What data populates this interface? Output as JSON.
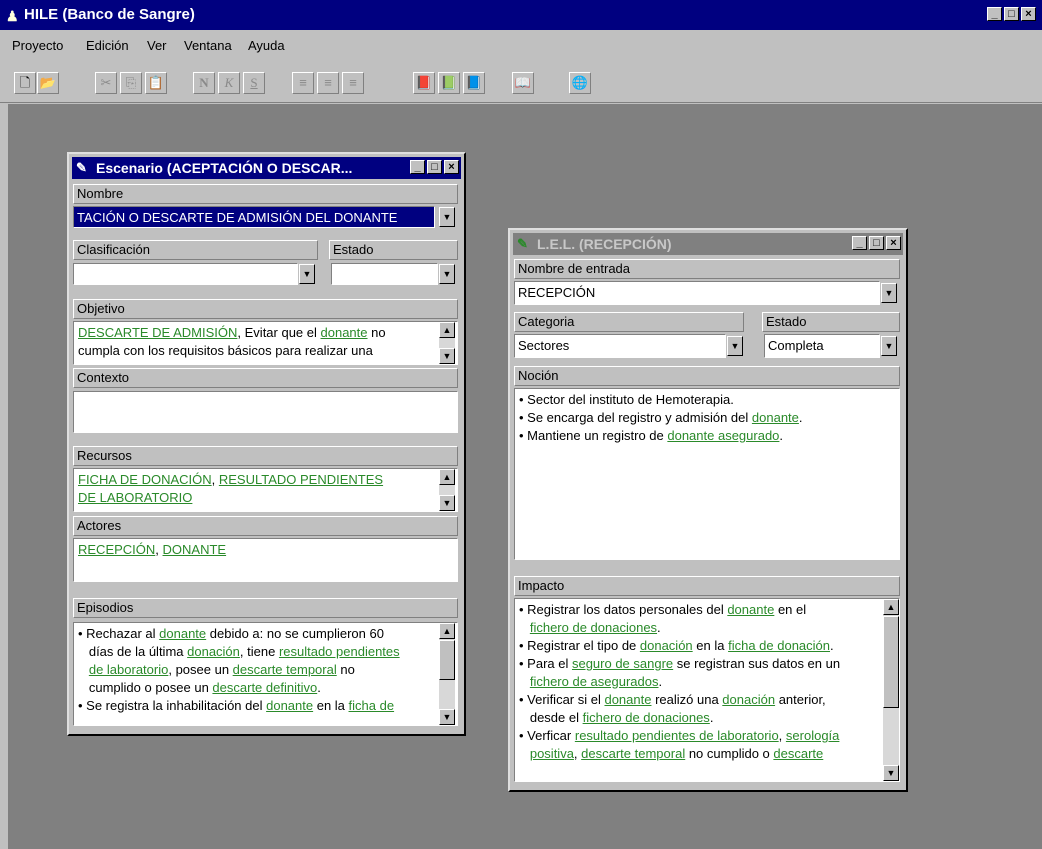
{
  "app": {
    "title": "HILE (Banco de Sangre)",
    "icon": "people-icon",
    "controls": [
      "_",
      "□",
      "×"
    ]
  },
  "menu": [
    "Proyecto",
    "Edición",
    "Ver",
    "Ventana",
    "Ayuda"
  ],
  "toolbar": {
    "buttons": [
      {
        "name": "new-file-icon",
        "glyph": "🗋",
        "enabled": true
      },
      {
        "name": "open-folder-icon",
        "glyph": "📂",
        "enabled": true
      },
      {
        "name": "cut-icon",
        "glyph": "✂",
        "enabled": false
      },
      {
        "name": "copy-icon",
        "glyph": "⎘",
        "enabled": false
      },
      {
        "name": "paste-icon",
        "glyph": "📋",
        "enabled": false
      },
      {
        "name": "bold-icon",
        "glyph": "N",
        "enabled": false
      },
      {
        "name": "italic-icon",
        "glyph": "K",
        "enabled": false
      },
      {
        "name": "underline-icon",
        "glyph": "S",
        "enabled": false
      },
      {
        "name": "align-left-icon",
        "glyph": "≡",
        "enabled": false
      },
      {
        "name": "align-center-icon",
        "glyph": "≡",
        "enabled": false
      },
      {
        "name": "align-right-icon",
        "glyph": "≡",
        "enabled": false
      },
      {
        "name": "scenario-book-icon",
        "glyph": "📕",
        "enabled": true
      },
      {
        "name": "lel-green-book-icon",
        "glyph": "📗",
        "enabled": true
      },
      {
        "name": "blue-book-icon",
        "glyph": "📘",
        "enabled": true
      },
      {
        "name": "open-book-icon",
        "glyph": "📖",
        "enabled": true
      },
      {
        "name": "help-globe-icon",
        "glyph": "🌐",
        "enabled": true
      }
    ]
  },
  "scenario": {
    "title": "Escenario (ACEPTACIÓN O DESCAR...",
    "nombre_label": "Nombre",
    "nombre_value": "TACIÓN O DESCARTE DE ADMISIÓN DEL DONANTE",
    "clasificacion_label": "Clasificación",
    "clasificacion_value": "",
    "estado_label": "Estado",
    "estado_value": "",
    "objetivo_label": "Objetivo",
    "contexto_label": "Contexto",
    "recursos_label": "Recursos",
    "actores_label": "Actores",
    "episodios_label": "Episodios",
    "objetivo": [
      [
        {
          "t": "DESCARTE DE ADMISIÓN",
          "l": true
        },
        {
          "t": ", Evitar que el "
        },
        {
          "t": "donante",
          "l": true
        },
        {
          "t": " no"
        }
      ],
      [
        {
          "t": "cumpla con los requisitos básicos para realizar una"
        }
      ]
    ],
    "recursos": [
      [
        {
          "t": "FICHA DE DONACIÓN",
          "l": true
        },
        {
          "t": ", "
        },
        {
          "t": "RESULTADO PENDIENTES",
          "l": true
        }
      ],
      [
        {
          "t": "DE LABORATORIO",
          "l": true
        }
      ]
    ],
    "actores": [
      [
        {
          "t": "RECEPCIÓN",
          "l": true
        },
        {
          "t": ", "
        },
        {
          "t": "DONANTE",
          "l": true
        }
      ]
    ],
    "episodios": [
      [
        {
          "t": "• Rechazar al "
        },
        {
          "t": "donante",
          "l": true
        },
        {
          "t": " debido a: no se cumplieron 60"
        }
      ],
      [
        {
          "t": "  días de la última "
        },
        {
          "t": "donación",
          "l": true
        },
        {
          "t": ", tiene "
        },
        {
          "t": "resultado pendientes",
          "l": true
        }
      ],
      [
        {
          "t": "  "
        },
        {
          "t": "de laboratorio",
          "l": true
        },
        {
          "t": ", posee un "
        },
        {
          "t": "descarte temporal",
          "l": true
        },
        {
          "t": " no"
        }
      ],
      [
        {
          "t": "  cumplido o posee un "
        },
        {
          "t": "descarte definitivo",
          "l": true
        },
        {
          "t": "."
        }
      ],
      [
        {
          "t": "• Se registra la inhabilitación del "
        },
        {
          "t": "donante",
          "l": true
        },
        {
          "t": " en la "
        },
        {
          "t": "ficha de",
          "l": true
        }
      ]
    ]
  },
  "lel": {
    "title": "L.E.L. (RECEPCIÓN)",
    "nombre_label": "Nombre de entrada",
    "nombre_value": "RECEPCIÓN",
    "categoria_label": "Categoria",
    "categoria_value": "Sectores",
    "estado_label": "Estado",
    "estado_value": "Completa",
    "nocion_label": "Noción",
    "impacto_label": "Impacto",
    "nocion": [
      [
        {
          "t": "• Sector del instituto de Hemoterapia."
        }
      ],
      [
        {
          "t": "• Se encarga del registro y admisión del "
        },
        {
          "t": "donante",
          "l": true
        },
        {
          "t": "."
        }
      ],
      [
        {
          "t": "• Mantiene un registro de "
        },
        {
          "t": "donante asegurado",
          "l": true
        },
        {
          "t": "."
        }
      ]
    ],
    "impacto": [
      [
        {
          "t": "• Registrar los datos personales del "
        },
        {
          "t": "donante",
          "l": true
        },
        {
          "t": " en el"
        }
      ],
      [
        {
          "t": "  "
        },
        {
          "t": "fichero de donaciones",
          "l": true
        },
        {
          "t": "."
        }
      ],
      [
        {
          "t": "• Registrar el tipo de "
        },
        {
          "t": "donación",
          "l": true
        },
        {
          "t": " en la "
        },
        {
          "t": "ficha de donación",
          "l": true
        },
        {
          "t": "."
        }
      ],
      [
        {
          "t": "• Para el "
        },
        {
          "t": "seguro de sangre",
          "l": true
        },
        {
          "t": " se registran sus datos en un"
        }
      ],
      [
        {
          "t": "  "
        },
        {
          "t": "fichero de asegurados",
          "l": true
        },
        {
          "t": "."
        }
      ],
      [
        {
          "t": "• Verificar si el "
        },
        {
          "t": "donante",
          "l": true
        },
        {
          "t": " realizó una "
        },
        {
          "t": "donación",
          "l": true
        },
        {
          "t": " anterior,"
        }
      ],
      [
        {
          "t": "  desde el "
        },
        {
          "t": "fichero de donaciones",
          "l": true
        },
        {
          "t": "."
        }
      ],
      [
        {
          "t": "• Verficar "
        },
        {
          "t": "resultado pendientes de laboratorio",
          "l": true
        },
        {
          "t": ", "
        },
        {
          "t": "serología",
          "l": true
        }
      ],
      [
        {
          "t": "  "
        },
        {
          "t": "positiva",
          "l": true
        },
        {
          "t": ", "
        },
        {
          "t": "descarte temporal",
          "l": true
        },
        {
          "t": " no cumplido o "
        },
        {
          "t": "descarte",
          "l": true
        }
      ]
    ]
  },
  "colors": {
    "title_active": "#000080",
    "title_inactive": "#808080",
    "link": "#2a8a2a",
    "mdi_bg": "#808080",
    "face": "#c0c0c0"
  }
}
